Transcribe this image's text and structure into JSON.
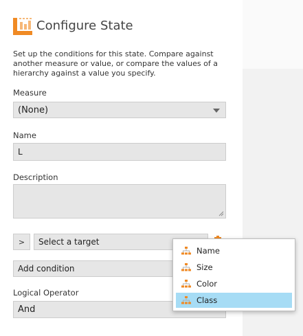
{
  "header": {
    "title": "Configure State",
    "icon": "state-config-icon"
  },
  "intro": "Set up the conditions for this state. Compare against another measure or value, or compare the values of a hierarchy against a value you specify.",
  "measure": {
    "label": "Measure",
    "value": "(None)"
  },
  "name": {
    "label": "Name",
    "value": "L"
  },
  "description": {
    "label": "Description",
    "value": ""
  },
  "condition": {
    "operator_button": ">",
    "target_placeholder": "Select a target"
  },
  "add_condition": "Add condition",
  "logical_operator": {
    "label": "Logical Operator",
    "value": "And"
  },
  "target_menu": {
    "items": [
      {
        "label": "Name",
        "icon": "hierarchy-icon",
        "selected": false
      },
      {
        "label": "Size",
        "icon": "hierarchy-icon",
        "selected": false
      },
      {
        "label": "Color",
        "icon": "hierarchy-icon",
        "selected": false
      },
      {
        "label": "Class",
        "icon": "hierarchy-icon",
        "selected": true
      }
    ]
  },
  "colors": {
    "accent": "#f08a24",
    "selected_item": "#a6dcf5",
    "field_bg": "#e6e6e6"
  }
}
